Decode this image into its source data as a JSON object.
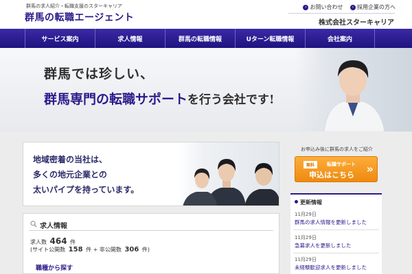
{
  "header": {
    "tagline": "群馬の求人紹介・転職支援のスターキャリア",
    "logo": "群馬の転職エージェント",
    "links": [
      "お問い合わせ",
      "採用企業の方へ"
    ],
    "company": "株式会社スターキャリア"
  },
  "nav": {
    "items": [
      "サービス案内",
      "求人情報",
      "群馬の転職情報",
      "Uターン転職情報",
      "会社案内"
    ]
  },
  "hero": {
    "line1": "群馬では珍しい、",
    "line2_highlight": "群馬専門の転職サポート",
    "line2_rest": "を行う会社です!"
  },
  "banner": {
    "lines": [
      "地域密着の当社は、",
      "多くの地元企業との",
      "太いパイプを持っています。"
    ]
  },
  "jobs": {
    "title": "求人情報",
    "count_label": "求人数",
    "count_value": "464",
    "count_unit": "件",
    "public_label": "(サイト公開数",
    "public_value": "158",
    "public_unit": "件",
    "plus": "+",
    "private_label": "非公開数",
    "private_value": "306",
    "private_unit": "件)",
    "browse_label": "職種から探す"
  },
  "sidebar": {
    "caption": "お申込み後に群馬の求人をご紹介",
    "apply": {
      "badge": "無料",
      "sub": "転職サポート",
      "main": "申込はこちら",
      "chevron": "»"
    },
    "news": {
      "title": "更新情報",
      "items": [
        {
          "date": "11月29日",
          "text": "群馬の求人情報を更新しました"
        },
        {
          "date": "11月29日",
          "text": "急募求人を更新しました"
        },
        {
          "date": "11月29日",
          "text": "未経験歓迎求人を更新しました"
        }
      ]
    }
  },
  "colors": {
    "brand": "#2b1a8c",
    "accent_orange": "#f39a1e"
  },
  "icons": {
    "link_arrow": "arrow-circle-icon",
    "search": "search-icon",
    "news_bullet": "circle-bullet-icon"
  }
}
